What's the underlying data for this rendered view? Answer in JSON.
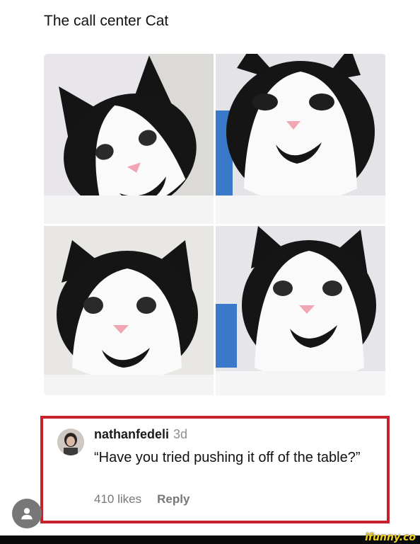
{
  "post": {
    "title": "The call center Cat",
    "photos": [
      {
        "subject": "cat-photo",
        "pose": "head tilted left"
      },
      {
        "subject": "cat-photo",
        "pose": "looking down"
      },
      {
        "subject": "cat-photo",
        "pose": "facing forward"
      },
      {
        "subject": "cat-photo",
        "pose": "looking down right"
      }
    ]
  },
  "comment": {
    "username": "nathanfedeli",
    "age": "3d",
    "text": "“Have you tried pushing it off of the table?”",
    "likes": "410 likes",
    "reply_label": "Reply",
    "highlight_color": "#c8202c"
  },
  "profile_button": {
    "icon": "person-icon"
  },
  "watermark": {
    "text": "ifunny.co",
    "color": "#f2d31b"
  }
}
